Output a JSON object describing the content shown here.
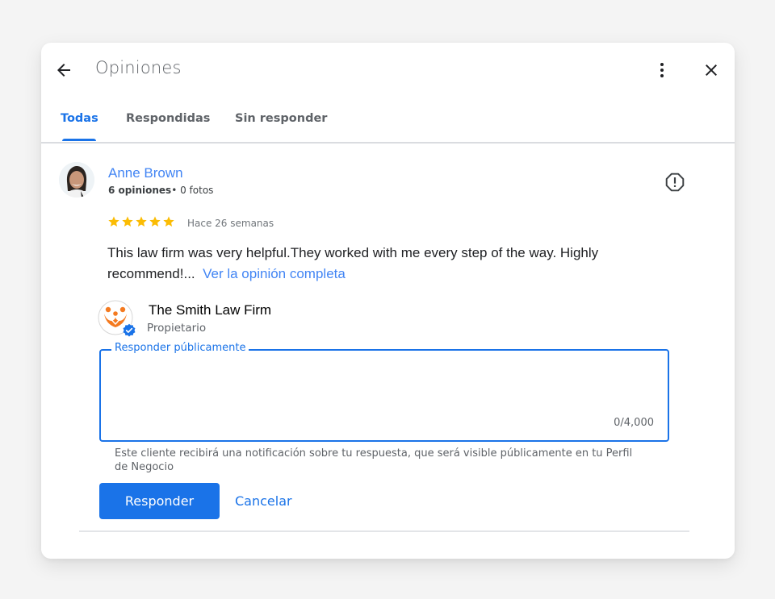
{
  "header": {
    "title": "Opiniones",
    "back_icon": "arrow-left-icon",
    "more_icon": "more-vert-icon",
    "close_icon": "close-icon"
  },
  "tabs": [
    {
      "label": "Todas",
      "active": true
    },
    {
      "label": "Respondidas",
      "active": false
    },
    {
      "label": "Sin responder",
      "active": false
    }
  ],
  "review": {
    "reviewer_name": "Anne Brown",
    "reviews_count": "6 opiniones",
    "meta_separator": "•",
    "photos_count": "0 fotos",
    "rating": 5,
    "rating_max": 5,
    "time": "Hace 26 semanas",
    "text": "This law firm was very helpful.They worked with me every step of the way. Highly recommend!...",
    "see_full_link": "Ver la opinión completa",
    "report_icon": "report-octagon-icon",
    "star_color": "#fbbc04"
  },
  "owner": {
    "name": "The Smith Law Firm",
    "role": "Propietario",
    "verified": true,
    "logo_color": "#f47a20",
    "verified_color": "#1a73e8"
  },
  "reply": {
    "label": "Responder públicamente",
    "value": "",
    "char_count": "0/4,000",
    "helper_text": "Este cliente recibirá una notificación sobre tu respuesta, que será visible públicamente en tu Perfil de Negocio",
    "submit_label": "Responder",
    "cancel_label": "Cancelar"
  },
  "colors": {
    "accent": "#1a73e8",
    "link": "#4285f4"
  }
}
